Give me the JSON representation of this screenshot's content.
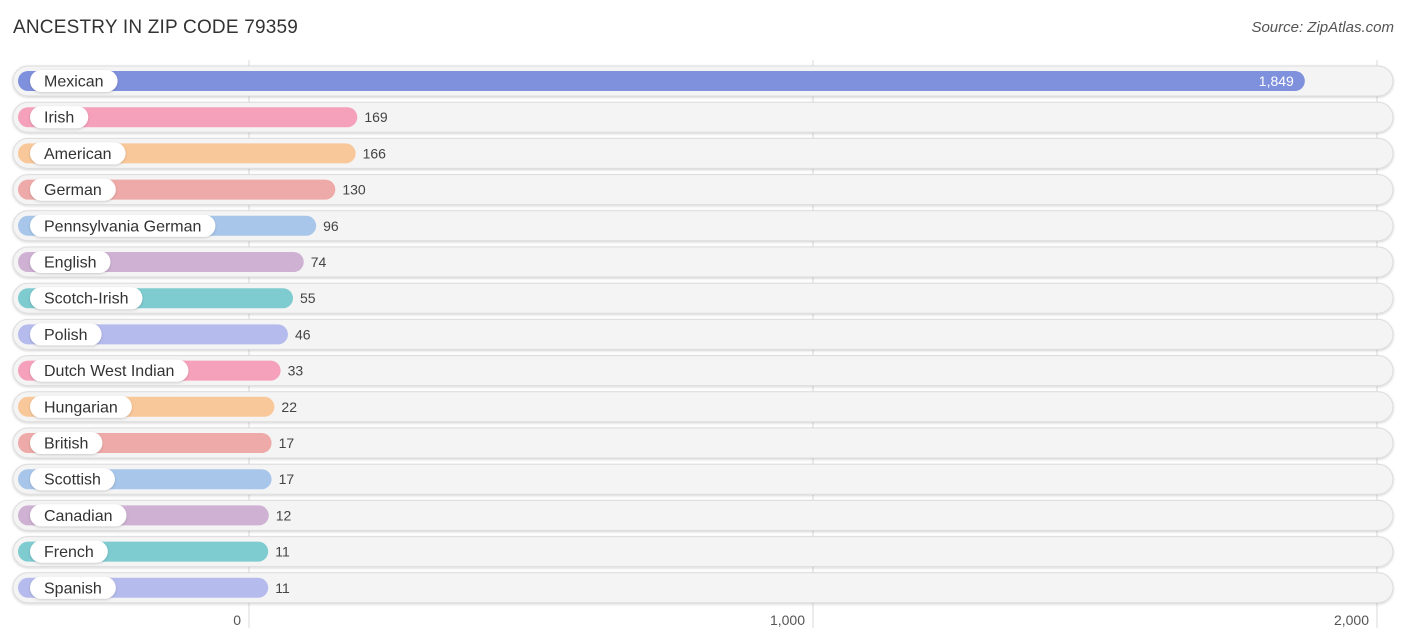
{
  "header": {
    "title": "ANCESTRY IN ZIP CODE 79359",
    "source": "Source: ZipAtlas.com"
  },
  "chart_data": {
    "type": "bar",
    "orientation": "horizontal",
    "title": "ANCESTRY IN ZIP CODE 79359",
    "xlabel": "",
    "ylabel": "",
    "xlim": [
      0,
      2000
    ],
    "x_ticks": [
      0,
      1000,
      2000
    ],
    "x_tick_labels": [
      "0",
      "1,000",
      "2,000"
    ],
    "grid": true,
    "categories": [
      "Mexican",
      "Irish",
      "American",
      "German",
      "Pennsylvania German",
      "English",
      "Scotch-Irish",
      "Polish",
      "Dutch West Indian",
      "Hungarian",
      "British",
      "Scottish",
      "Canadian",
      "French",
      "Spanish"
    ],
    "values": [
      1849,
      169,
      166,
      130,
      96,
      74,
      55,
      46,
      33,
      22,
      17,
      17,
      12,
      11,
      11
    ],
    "value_labels": [
      "1,849",
      "169",
      "166",
      "130",
      "96",
      "74",
      "55",
      "46",
      "33",
      "22",
      "17",
      "17",
      "12",
      "11",
      "11"
    ],
    "colors": [
      "#7f90dc",
      "#f6a1bc",
      "#f9c89a",
      "#eeaaa8",
      "#a7c6ea",
      "#ceb1d3",
      "#7ecbd0",
      "#b5bced",
      "#f6a1bc",
      "#f9c89a",
      "#eeaaa8",
      "#a7c6ea",
      "#ceb1d3",
      "#7ecbd0",
      "#b5bced"
    ]
  }
}
